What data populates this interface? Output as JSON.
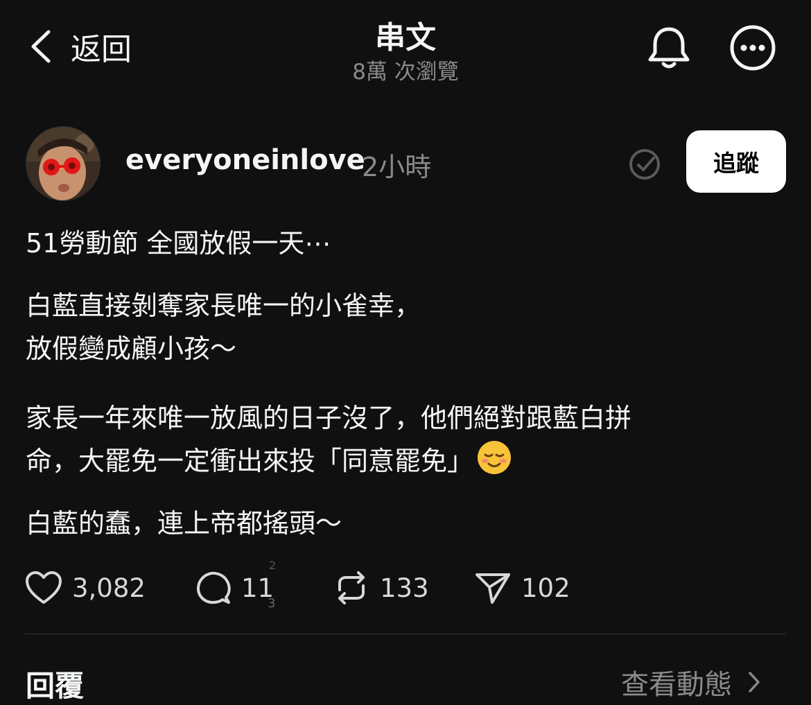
{
  "header": {
    "back_label": "返回",
    "title": "串文",
    "views": "8萬 次瀏覽"
  },
  "icons": {
    "back": "chevron-left-icon",
    "bell": "bell-icon",
    "more": "more-options-icon",
    "verified": "badge-check-icon",
    "like": "heart-icon",
    "comment": "comment-icon",
    "repost": "repost-icon",
    "share": "send-icon",
    "chevron": "chevron-right-icon"
  },
  "author": {
    "username": "everyoneinlove",
    "time": "2小時",
    "follow_label": "追蹤"
  },
  "post": {
    "p1": "51勞動節 全國放假一天⋯",
    "p2_line1": "白藍直接剝奪家長唯一的小雀幸，",
    "p2_line2": "放假變成顧小孩～",
    "p3_line1": "家長一年來唯一放風的日子沒了，他們絕對跟藍白拼",
    "p3_line2": "命，大罷免一定衝出來投「同意罷免」",
    "p4": "白藍的蠢，連上帝都搖頭～"
  },
  "actions": {
    "likes": "3,082",
    "comments": "11",
    "reposts": "133",
    "shares": "102",
    "ghost_top": "2",
    "ghost_bottom": "3"
  },
  "replies": {
    "label": "回覆",
    "view_activity": "查看動態"
  },
  "colors": {
    "background": "#101010",
    "text": "#f3f5f7",
    "muted": "#8a8a8a",
    "follow_bg": "#ffffff",
    "follow_text": "#000000"
  }
}
